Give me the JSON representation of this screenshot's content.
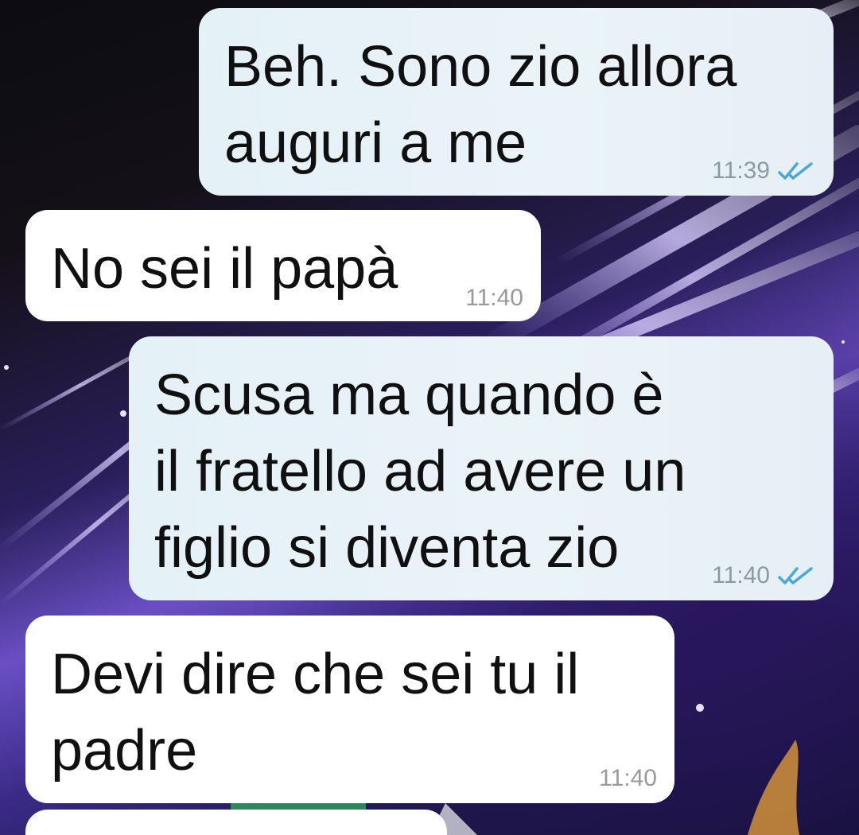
{
  "colors": {
    "outgoing_bubble": "#e6f1f7",
    "incoming_bubble": "#ffffff",
    "read_ticks": "#4aa8d8",
    "timestamp": "#8a9aa2"
  },
  "messages": [
    {
      "direction": "outgoing",
      "text": "Beh. Sono zio allora\nauguri a me",
      "time": "11:39",
      "status_icon": "double-check-read-icon"
    },
    {
      "direction": "incoming",
      "text": "No sei il papà",
      "time": "11:40"
    },
    {
      "direction": "outgoing",
      "text": "Scusa ma quando è\nil fratello ad avere un\nfiglio si diventa zio",
      "time": "11:40",
      "status_icon": "double-check-read-icon"
    },
    {
      "direction": "incoming",
      "text": "Devi dire che sei tu il\npadre",
      "time": "11:40"
    }
  ]
}
